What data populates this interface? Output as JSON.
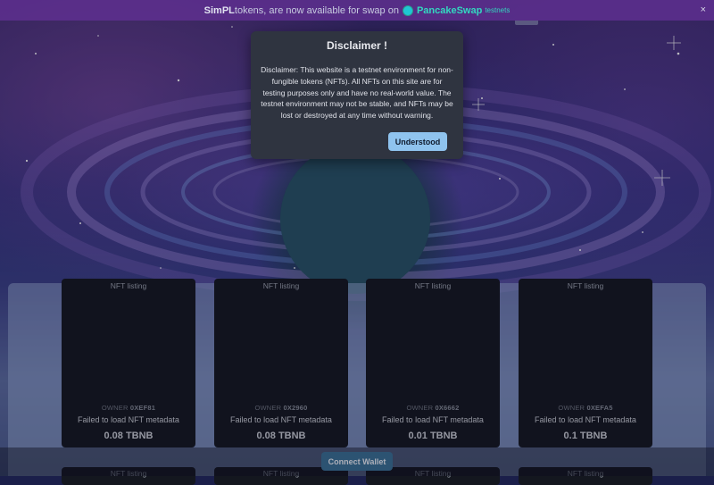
{
  "banner": {
    "brand": "SimPL",
    "text": " tokens, are now available for swap on",
    "link": "PancakeSwap",
    "tag": "testnets",
    "close": "×"
  },
  "modal": {
    "title": "Disclaimer !",
    "body": "Disclaimer: This website is a testnet environment for non-fungible tokens (NFTs). All NFTs on this site are for testing purposes only and have no real-world value. The testnet environment may not be stable, and NFTs may be lost or destroyed at any time without warning.",
    "button": "Understood"
  },
  "listings": [
    {
      "alt": "NFT listing",
      "owner_label": "OWNER",
      "owner": "0XEF81",
      "meta": "Failed to load NFT metadata",
      "price": "0.08 TBNB"
    },
    {
      "alt": "NFT listing",
      "owner_label": "OWNER",
      "owner": "0X2960",
      "meta": "Failed to load NFT metadata",
      "price": "0.08 TBNB"
    },
    {
      "alt": "NFT listing",
      "owner_label": "OWNER",
      "owner": "0X6662",
      "meta": "Failed to load NFT metadata",
      "price": "0.01 TBNB"
    },
    {
      "alt": "NFT listing",
      "owner_label": "OWNER",
      "owner": "0XEFA5",
      "meta": "Failed to load NFT metadata",
      "price": "0.1 TBNB"
    }
  ],
  "listings_row2": [
    {
      "alt": "NFT listing"
    },
    {
      "alt": "NFT listing"
    },
    {
      "alt": "NFT listing"
    },
    {
      "alt": "NFT listing"
    }
  ],
  "connect_button": "Connect Wallet",
  "colors": {
    "banner": "#5f3091",
    "accent_button": "#8fc3ee",
    "connect_button": "#3a6f93",
    "card": "#14171f",
    "pancakeswap": "#33d7c0"
  }
}
